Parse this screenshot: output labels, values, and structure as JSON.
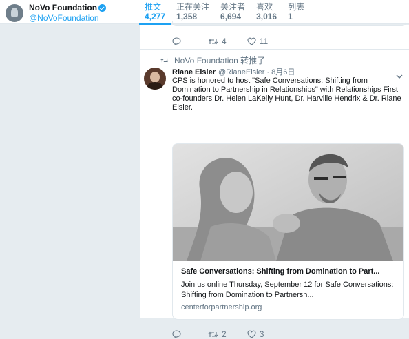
{
  "profile": {
    "name": "NoVo Foundation",
    "handle": "@NoVoFoundation"
  },
  "stats": [
    {
      "label": "推文",
      "value": "4,277",
      "active": true
    },
    {
      "label": "正在关注",
      "value": "1,358",
      "active": false
    },
    {
      "label": "关注者",
      "value": "6,694",
      "active": false
    },
    {
      "label": "喜欢",
      "value": "3,016",
      "active": false
    },
    {
      "label": "列表",
      "value": "1",
      "active": false
    }
  ],
  "previous_tweet": {
    "retweets": "4",
    "likes": "11"
  },
  "tweet": {
    "retweeted_by": "NoVo Foundation 转推了",
    "author_name": "Riane Eisler",
    "author_handle": "@RianeEisler",
    "separator": "·",
    "date": "8月6日",
    "text": "CPS is honored to host \"Safe Conversations: Shifting from Domination to Partnership in Relationships\" with Relationships First co-founders Dr. Helen LaKelly Hunt, Dr. Harville Hendrix & Dr. Riane Eisler.",
    "card": {
      "title": "Safe Conversations: Shifting from Domination to Part...",
      "description": "Join us online Thursday, September 12 for Safe Conversations: Shifting from Domination to Partnersh...",
      "url": "centerforpartnership.org"
    },
    "retweets": "2",
    "likes": "3"
  },
  "colors": {
    "accent": "#1da1f2",
    "muted": "#657786",
    "background": "#e6ecf0"
  },
  "icons": [
    "verified-badge-icon",
    "reply-icon",
    "retweet-icon",
    "like-icon",
    "caret-down-icon"
  ]
}
